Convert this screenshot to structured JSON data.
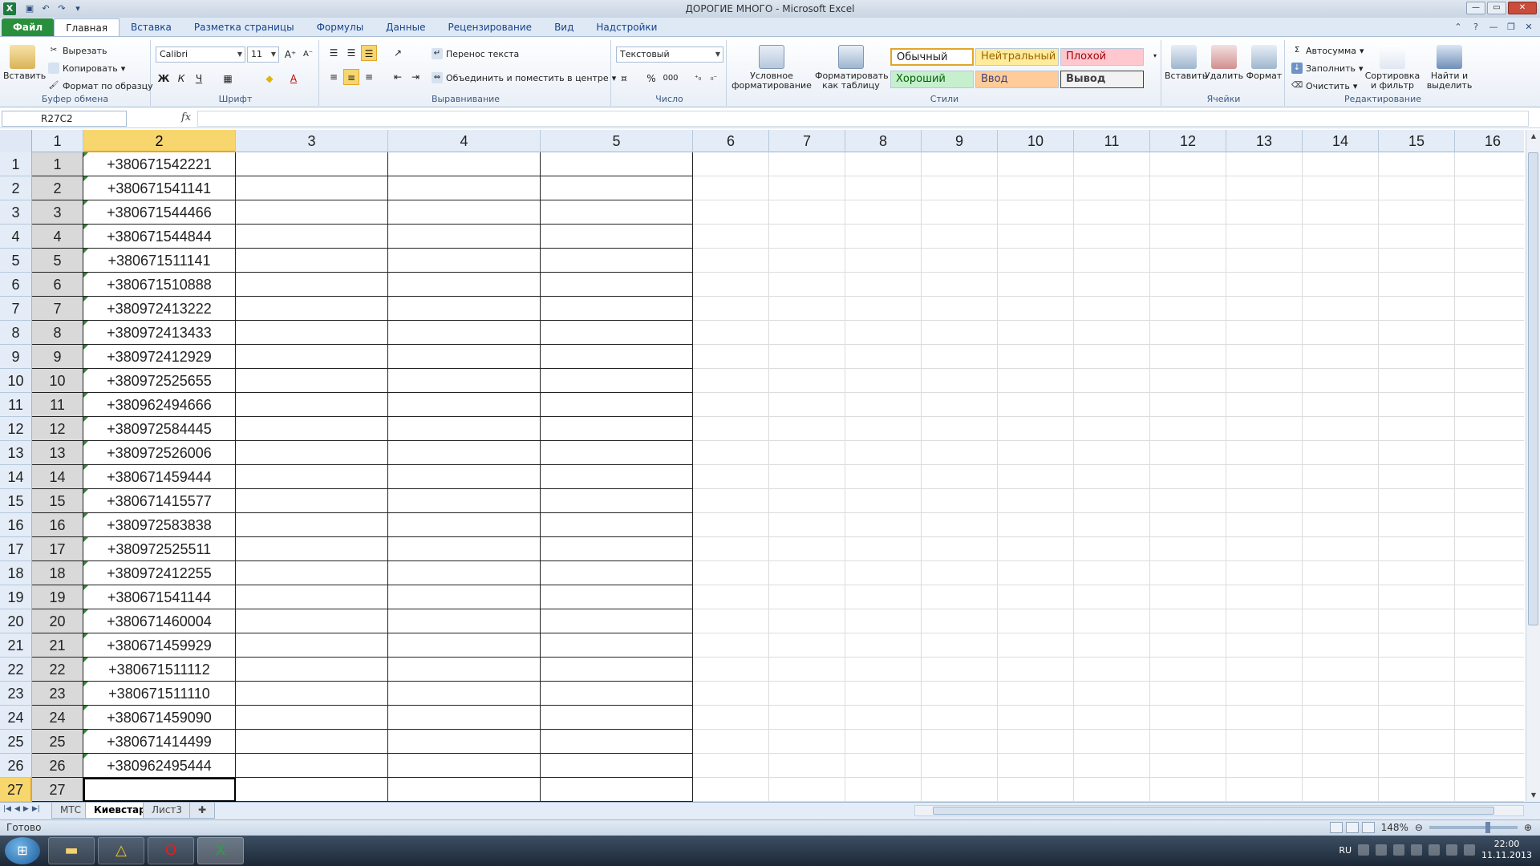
{
  "window": {
    "title": "ДОРОГИЕ МНОГО - Microsoft Excel",
    "app_icon": "X"
  },
  "ribbon_tabs": [
    "Файл",
    "Главная",
    "Вставка",
    "Разметка страницы",
    "Формулы",
    "Данные",
    "Рецензирование",
    "Вид",
    "Надстройки"
  ],
  "clipboard": {
    "paste": "Вставить",
    "cut": "Вырезать",
    "copy": "Копировать",
    "format_painter": "Формат по образцу",
    "label": "Буфер обмена"
  },
  "font": {
    "name": "Calibri",
    "size": "11",
    "bold": "Ж",
    "italic": "К",
    "underline": "Ч",
    "label": "Шрифт"
  },
  "alignment": {
    "wrap": "Перенос текста",
    "merge": "Объединить и поместить в центре",
    "label": "Выравнивание"
  },
  "number": {
    "format": "Текстовый",
    "percent": "%",
    "thousands": "000",
    "label": "Число"
  },
  "styles": {
    "conditional": "Условное форматирование",
    "as_table": "Форматировать как таблицу",
    "normal": "Обычный",
    "neutral": "Нейтральный",
    "bad": "Плохой",
    "good": "Хороший",
    "input": "Ввод",
    "output": "Вывод",
    "label": "Стили"
  },
  "cells_group": {
    "insert": "Вставить",
    "delete": "Удалить",
    "format": "Формат",
    "label": "Ячейки"
  },
  "editing": {
    "autosum": "Автосумма",
    "fill": "Заполнить",
    "clear": "Очистить",
    "sort": "Сортировка и фильтр",
    "find": "Найти и выделить",
    "label": "Редактирование"
  },
  "formula_bar": {
    "name_box": "R27C2",
    "fx": "fx",
    "value": ""
  },
  "columns": [
    "1",
    "2",
    "3",
    "4",
    "5",
    "6",
    "7",
    "8",
    "9",
    "10",
    "11",
    "12",
    "13",
    "14",
    "15",
    "16"
  ],
  "rows": [
    {
      "n": "1",
      "phone": "+380671542221"
    },
    {
      "n": "2",
      "phone": "+380671541141"
    },
    {
      "n": "3",
      "phone": "+380671544466"
    },
    {
      "n": "4",
      "phone": "+380671544844"
    },
    {
      "n": "5",
      "phone": "+380671511141"
    },
    {
      "n": "6",
      "phone": "+380671510888"
    },
    {
      "n": "7",
      "phone": "+380972413222"
    },
    {
      "n": "8",
      "phone": "+380972413433"
    },
    {
      "n": "9",
      "phone": "+380972412929"
    },
    {
      "n": "10",
      "phone": "+380972525655"
    },
    {
      "n": "11",
      "phone": "+380962494666"
    },
    {
      "n": "12",
      "phone": "+380972584445"
    },
    {
      "n": "13",
      "phone": "+380972526006"
    },
    {
      "n": "14",
      "phone": "+380671459444"
    },
    {
      "n": "15",
      "phone": "+380671415577"
    },
    {
      "n": "16",
      "phone": "+380972583838"
    },
    {
      "n": "17",
      "phone": "+380972525511"
    },
    {
      "n": "18",
      "phone": "+380972412255"
    },
    {
      "n": "19",
      "phone": "+380671541144"
    },
    {
      "n": "20",
      "phone": "+380671460004"
    },
    {
      "n": "21",
      "phone": "+380671459929"
    },
    {
      "n": "22",
      "phone": "+380671511112"
    },
    {
      "n": "23",
      "phone": "+380671511110"
    },
    {
      "n": "24",
      "phone": "+380671459090"
    },
    {
      "n": "25",
      "phone": "+380671414499"
    },
    {
      "n": "26",
      "phone": "+380962495444"
    },
    {
      "n": "27",
      "phone": ""
    }
  ],
  "sheets": [
    "МТС",
    "Киевстар",
    "Лист3"
  ],
  "active_sheet": "Киевстар",
  "status": {
    "ready": "Готово",
    "zoom": "148%"
  },
  "taskbar": {
    "lang": "RU",
    "time": "22:00",
    "date": "11.11.2013"
  },
  "colors": {
    "selected_header": "#f8d66e",
    "gray_cell": "#d9d9d9",
    "file_tab": "#2a8f3d"
  }
}
